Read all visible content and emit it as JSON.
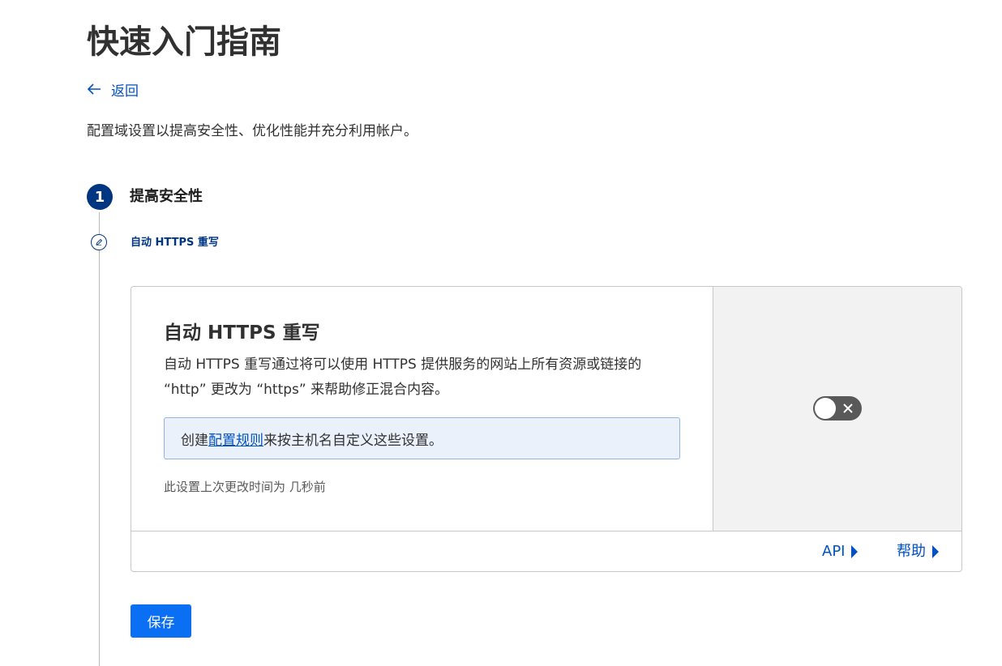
{
  "page": {
    "title": "快速入门指南",
    "back_label": "返回",
    "intro": "配置域设置以提高安全性、优化性能并充分利用帐户。"
  },
  "step": {
    "number": "1",
    "title": "提高安全性",
    "substep_label": "自动 HTTPS 重写"
  },
  "card": {
    "title": "自动 HTTPS 重写",
    "description": "自动 HTTPS 重写通过将可以使用 HTTPS 提供服务的网站上所有资源或链接的 “http” 更改为 “https” 来帮助修正混合内容。",
    "info_prefix": "创建",
    "info_link": "配置规则",
    "info_suffix": "来按主机名自定义这些设置。",
    "last_updated": "此设置上次更改时间为 几秒前",
    "toggle_on": false,
    "footer_links": [
      {
        "label": "API"
      },
      {
        "label": "帮助"
      }
    ]
  },
  "actions": {
    "save_label": "保存"
  },
  "colors": {
    "accent": "#0051c3",
    "step_badge": "#003681",
    "primary_button": "#0a6ff3",
    "toggle_off": "#595959"
  }
}
